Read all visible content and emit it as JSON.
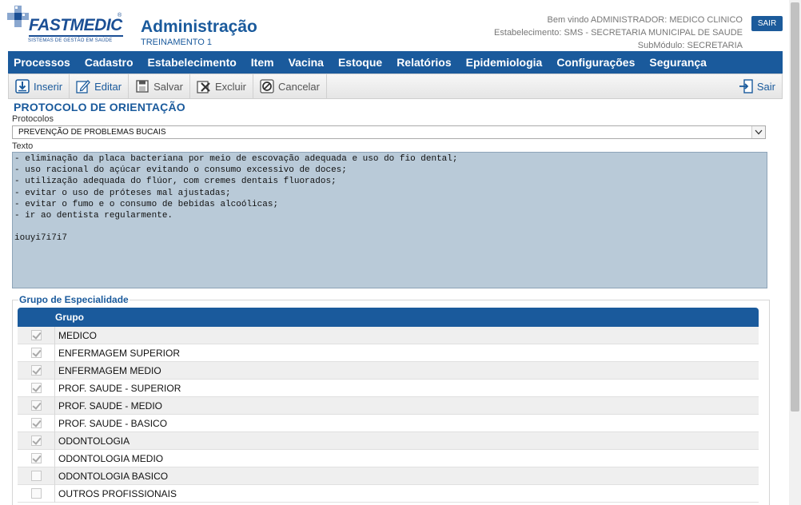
{
  "header": {
    "logo_text": "FASTMEDIC",
    "logo_tagline": "SISTEMAS DE GESTÃO EM SAÚDE",
    "registered_mark": "®",
    "app_title": "Administração",
    "app_subtitle": "TREINAMENTO 1",
    "welcome": "Bem vindo ADMINISTRADOR: MEDICO CLINICO",
    "establishment": "Estabelecimento: SMS - SECRETARIA MUNICIPAL DE SAUDE",
    "submodule": "SubMódulo: SECRETARIA",
    "logout_label": "SAIR"
  },
  "menu": [
    "Processos",
    "Cadastro",
    "Estabelecimento",
    "Item",
    "Vacina",
    "Estoque",
    "Relatórios",
    "Epidemiologia",
    "Configurações",
    "Segurança"
  ],
  "toolbar": {
    "insert": "Inserir",
    "edit": "Editar",
    "save": "Salvar",
    "delete": "Excluir",
    "cancel": "Cancelar",
    "exit": "Sair"
  },
  "form": {
    "section_title": "PROTOCOLO DE ORIENTAÇÃO",
    "protocol_label": "Protocolos",
    "protocol_value": "PREVENÇÃO DE PROBLEMAS BUCAIS",
    "text_label": "Texto",
    "text_value": "- eliminação da placa bacteriana por meio de escovação adequada e uso do fio dental;\n- uso racional do açúcar evitando o consumo excessivo de doces;\n- utilização adequada do flúor, com cremes dentais fluorados;\n- evitar o uso de próteses mal ajustadas;\n- evitar o fumo e o consumo de bebidas alcoólicas;\n- ir ao dentista regularmente.\n\niouyi7i7i7"
  },
  "group": {
    "title": "Grupo de Especialidade",
    "column_header": "Grupo",
    "rows": [
      {
        "name": "MEDICO",
        "checked": true
      },
      {
        "name": "ENFERMAGEM SUPERIOR",
        "checked": true
      },
      {
        "name": "ENFERMAGEM MEDIO",
        "checked": true
      },
      {
        "name": "PROF. SAUDE - SUPERIOR",
        "checked": true
      },
      {
        "name": "PROF. SAUDE - MEDIO",
        "checked": true
      },
      {
        "name": "PROF. SAUDE - BASICO",
        "checked": true
      },
      {
        "name": "ODONTOLOGIA",
        "checked": true
      },
      {
        "name": "ODONTOLOGIA MEDIO",
        "checked": true
      },
      {
        "name": "ODONTOLOGIA BASICO",
        "checked": false
      },
      {
        "name": "OUTROS PROFISSIONAIS",
        "checked": false
      }
    ]
  },
  "colors": {
    "brand_blue": "#1a5a9c",
    "textarea_bg": "#b9cad8"
  }
}
